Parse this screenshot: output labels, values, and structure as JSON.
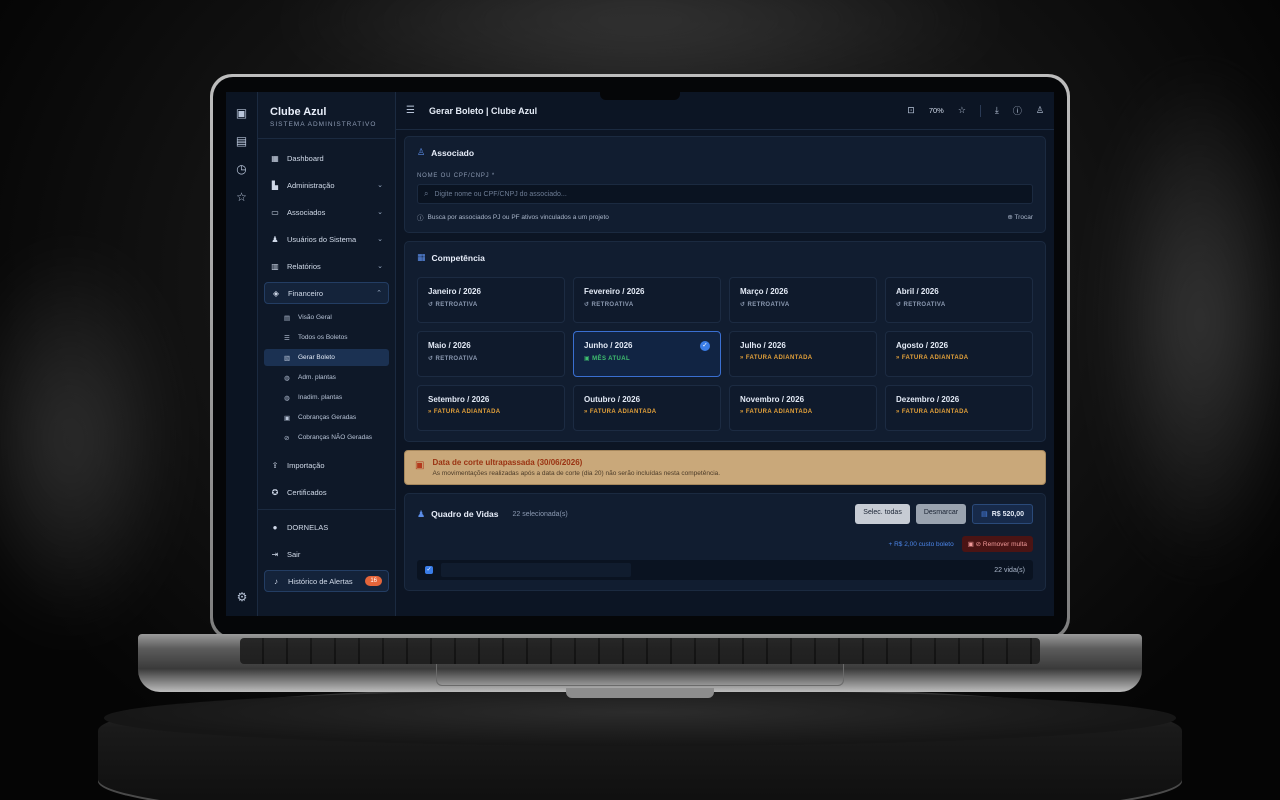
{
  "app": {
    "brand_title": "Clube Azul",
    "brand_subtitle": "SISTEMA ADMINISTRATIVO",
    "page_title": "Gerar Boleto | Clube Azul",
    "zoom": "70%"
  },
  "rail": {
    "icons": [
      "wallet-icon",
      "document-icon",
      "clock-icon",
      "star-icon",
      "settings-icon"
    ]
  },
  "sidebar": {
    "items": [
      {
        "label": "Dashboard",
        "icon": "grid-icon"
      },
      {
        "label": "Administração",
        "icon": "building-icon"
      },
      {
        "label": "Associados",
        "icon": "id-card-icon"
      },
      {
        "label": "Usuários do Sistema",
        "icon": "users-icon"
      },
      {
        "label": "Relatórios",
        "icon": "report-icon"
      },
      {
        "label": "Financeiro",
        "icon": "finance-icon"
      }
    ],
    "financeiro_sub": [
      {
        "label": "Visão Geral"
      },
      {
        "label": "Todos os Boletos"
      },
      {
        "label": "Gerar Boleto"
      },
      {
        "label": "Adm. plantas"
      },
      {
        "label": "Inadim. plantas"
      },
      {
        "label": "Cobranças Geradas"
      },
      {
        "label": "Cobranças NÃO Geradas"
      }
    ],
    "lower": [
      {
        "label": "Importação"
      },
      {
        "label": "Certificados"
      }
    ],
    "user": "DORNELAS",
    "logout": "Sair",
    "alerts_label": "Histórico de Alertas",
    "alerts_count": "16"
  },
  "associado": {
    "title": "Associado",
    "field_label": "NOME OU CPF/CNPJ *",
    "placeholder": "Digite nome ou CPF/CNPJ do associado...",
    "hint": "Busca por associados PJ ou PF ativos vinculados a um projeto",
    "trocar": "Trocar"
  },
  "competencia": {
    "title": "Competência",
    "months": [
      {
        "name": "Janeiro / 2026",
        "tag": "RETROATIVA",
        "kind": "past"
      },
      {
        "name": "Fevereiro / 2026",
        "tag": "RETROATIVA",
        "kind": "past"
      },
      {
        "name": "Março / 2026",
        "tag": "RETROATIVA",
        "kind": "past"
      },
      {
        "name": "Abril / 2026",
        "tag": "RETROATIVA",
        "kind": "past"
      },
      {
        "name": "Maio / 2026",
        "tag": "RETROATIVA",
        "kind": "past"
      },
      {
        "name": "Junho / 2026",
        "tag": "MÊS ATUAL",
        "kind": "current"
      },
      {
        "name": "Julho / 2026",
        "tag": "FATURA ADIANTADA",
        "kind": "future"
      },
      {
        "name": "Agosto / 2026",
        "tag": "FATURA ADIANTADA",
        "kind": "future"
      },
      {
        "name": "Setembro / 2026",
        "tag": "FATURA ADIANTADA",
        "kind": "future"
      },
      {
        "name": "Outubro / 2026",
        "tag": "FATURA ADIANTADA",
        "kind": "future"
      },
      {
        "name": "Novembro / 2026",
        "tag": "FATURA ADIANTADA",
        "kind": "future"
      },
      {
        "name": "Dezembro / 2026",
        "tag": "FATURA ADIANTADA",
        "kind": "future"
      }
    ]
  },
  "warning": {
    "title": "Data de corte ultrapassada (30/06/2026)",
    "text": "As movimentações realizadas após a data de corte (dia 20) não serão incluídas nesta competência."
  },
  "vidas": {
    "title": "Quadro de Vidas",
    "selected": "22 selecionada(s)",
    "select_all": "Selec. todas",
    "unselect": "Desmarcar",
    "total": "R$ 520,00",
    "cost": "+ R$ 2,00 custo boleto",
    "remove_fine": "Remover multa",
    "count": "22 vida(s)"
  },
  "colors": {
    "accent": "#3a7de8",
    "current": "#3fbf6f",
    "future": "#e2a03a",
    "badge": "#e5653a"
  }
}
